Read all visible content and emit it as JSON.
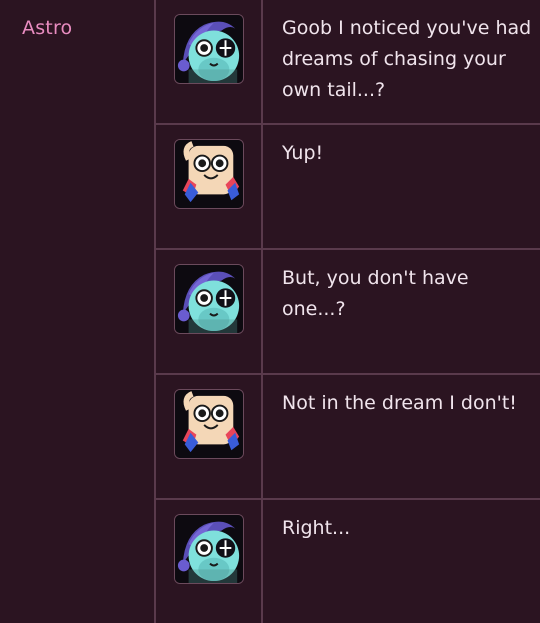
{
  "speaker": "Astro",
  "colors": {
    "background": "#2b1421",
    "grid": "#5a3a4c",
    "speaker_name": "#e88cc0",
    "text": "#f0e4ec"
  },
  "rows": [
    {
      "avatar": "astro-avatar-icon",
      "text": "Goob I noticed you've had dreams of chasing your own tail...?"
    },
    {
      "avatar": "goob-avatar-icon",
      "text": "Yup!"
    },
    {
      "avatar": "astro-avatar-icon",
      "text": "But, you don't have one...?"
    },
    {
      "avatar": "goob-avatar-icon",
      "text": "Not in the dream I don't!"
    },
    {
      "avatar": "astro-avatar-icon",
      "text": "Right..."
    }
  ]
}
